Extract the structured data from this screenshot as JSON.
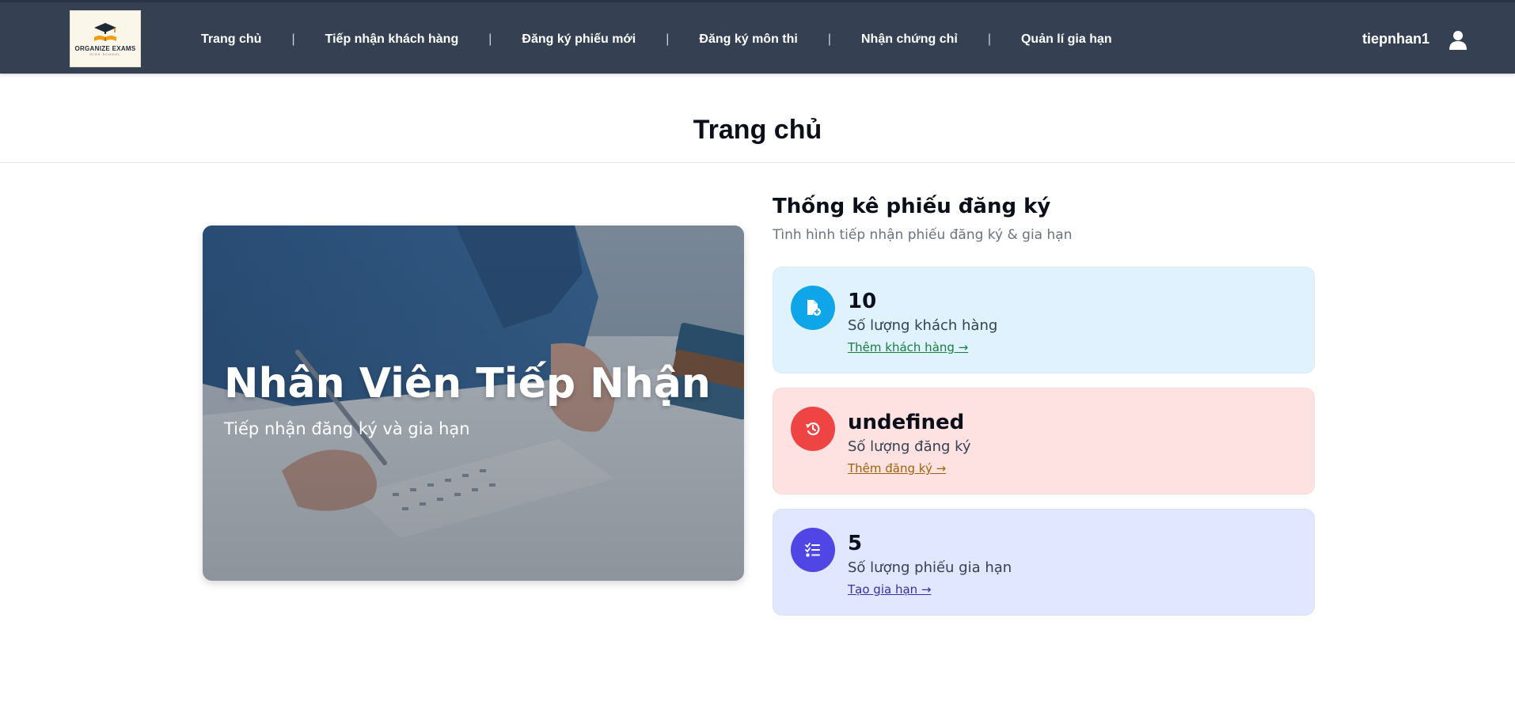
{
  "colors": {
    "header_bg": "#354153",
    "card_customers_bg": "#e0f2fe",
    "card_customers_icon": "#0ea5e9",
    "card_customers_link": "#15803d",
    "card_registrations_bg": "#fee2e2",
    "card_registrations_icon": "#ef4444",
    "card_registrations_link": "#a16207",
    "card_renewals_bg": "#e0e7ff",
    "card_renewals_icon": "#4f46e5",
    "card_renewals_link": "#3730a3"
  },
  "header": {
    "logo": {
      "text": "ORGANIZE EXAMS",
      "subtext": "HIGH SCHOOL",
      "icon": "graduation-cap-book-icon"
    },
    "nav": [
      {
        "label": "Trang chủ"
      },
      {
        "label": "Tiếp nhận khách hàng"
      },
      {
        "label": "Đăng ký phiếu mới"
      },
      {
        "label": "Đăng ký môn thi"
      },
      {
        "label": "Nhận chứng chỉ"
      },
      {
        "label": "Quản lí gia hạn"
      }
    ],
    "nav_separator": "|",
    "username": "tiepnhan1",
    "user_icon": "user-icon"
  },
  "page": {
    "title": "Trang chủ"
  },
  "hero": {
    "title": "Nhân Viên Tiếp Nhận",
    "subtitle": "Tiếp nhận đăng ký và gia hạn"
  },
  "stats": {
    "title": "Thống kê phiếu đăng ký",
    "subtitle": "Tình hình tiếp nhận phiếu đăng ký & gia hạn",
    "cards": [
      {
        "value": "10",
        "label": "Số lượng khách hàng",
        "link": "Thêm khách hàng →",
        "icon": "file-add-icon"
      },
      {
        "value": "undefined",
        "label": "Số lượng đăng ký",
        "link": "Thêm đăng ký →",
        "icon": "history-icon"
      },
      {
        "value": "5",
        "label": "Số lượng phiếu gia hạn",
        "link": "Tạo gia hạn →",
        "icon": "checklist-icon"
      }
    ]
  }
}
